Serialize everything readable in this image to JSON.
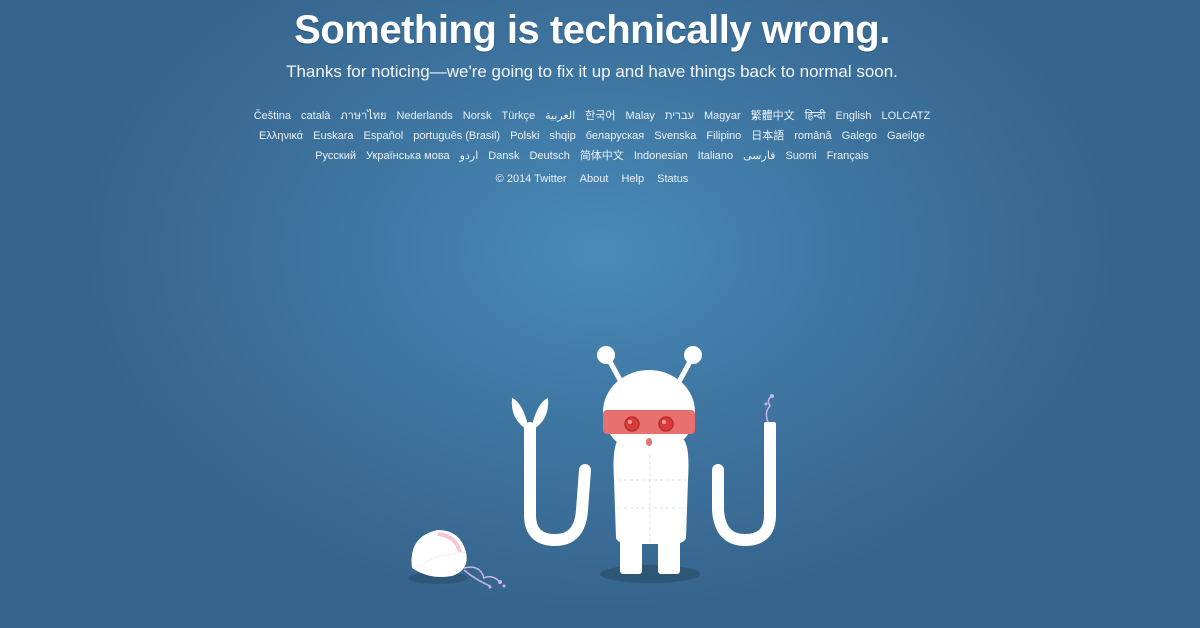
{
  "headline": "Something is technically wrong.",
  "subtitle": "Thanks for noticing—we're going to fix it up and have things back to normal soon.",
  "languages": [
    "Čeština",
    "català",
    "ภาษาไทย",
    "Nederlands",
    "Norsk",
    "Türkçe",
    "العربية",
    "한국어",
    "Malay",
    "עברית",
    "Magyar",
    "繁體中文",
    "हिन्दी",
    "English",
    "LOLCATZ",
    "Ελληνικά",
    "Euskara",
    "Español",
    "português (Brasil)",
    "Polski",
    "shqip",
    "беларуская",
    "Svenska",
    "Filipino",
    "日本語",
    "română",
    "Galego",
    "Gaeilge",
    "Русский",
    "Українська мова",
    "اردو",
    "Dansk",
    "Deutsch",
    "简体中文",
    "Indonesian",
    "Italiano",
    "فارسی",
    "Suomi",
    "Français"
  ],
  "footer": {
    "copyright": "© 2014 Twitter",
    "about": "About",
    "help": "Help",
    "status": "Status"
  },
  "colors": {
    "background": "#3f77a3",
    "robot_body": "#ffffff",
    "visor": "#e8706f",
    "eyes": "#d93b3b",
    "shadow": "#2e5677"
  }
}
